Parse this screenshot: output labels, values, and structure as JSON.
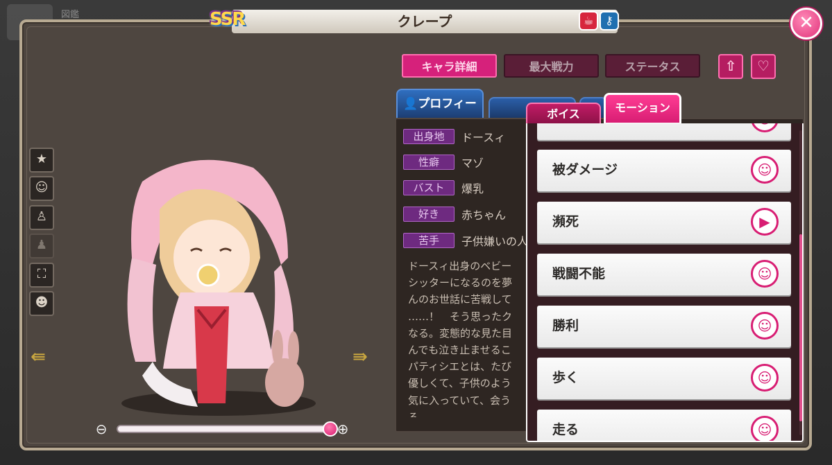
{
  "header": {
    "rarity": "SSR",
    "title": "クレープ",
    "top_left_label": "図鑑"
  },
  "top_tabs": {
    "detail": "キャラ詳細",
    "power": "最大戦力",
    "status": "ステータス"
  },
  "profile": {
    "tab_label": "プロフィール",
    "attributes": [
      {
        "label": "出身地",
        "value": "ドースィ"
      },
      {
        "label": "性癖",
        "value": "マゾ"
      },
      {
        "label": "バスト",
        "value": "爆乳"
      },
      {
        "label": "好き",
        "value": "赤ちゃん"
      },
      {
        "label": "苦手",
        "value": "子供嫌いの人"
      }
    ],
    "description": "ドースィ出身のベビー\nシッターになるのを夢\nんのお世話に苦戦して\n……！　そう思ったク\nなる。変態的な見た目\nんでも泣き止ませるこ\nパティシエとは、たび\n優しくて、子供のよう\n気に入っていて、会う\nる。"
  },
  "motion_panel": {
    "voice_tab": "ボイス",
    "motion_tab": "モーション",
    "items": [
      {
        "label": "被ダメージ",
        "icon": "person-icon"
      },
      {
        "label": "瀕死",
        "icon": "play-icon"
      },
      {
        "label": "戦闘不能",
        "icon": "person-icon"
      },
      {
        "label": "勝利",
        "icon": "person-icon"
      },
      {
        "label": "歩く",
        "icon": "person-icon"
      },
      {
        "label": "走る",
        "icon": "person-icon"
      }
    ]
  },
  "zoom": {
    "level": 1.0
  },
  "colors": {
    "accent_pink": "#d81d73",
    "attr_purple": "#6e2a80",
    "profile_blue": "#2f6fc0",
    "panel_dark": "#2e2622"
  }
}
